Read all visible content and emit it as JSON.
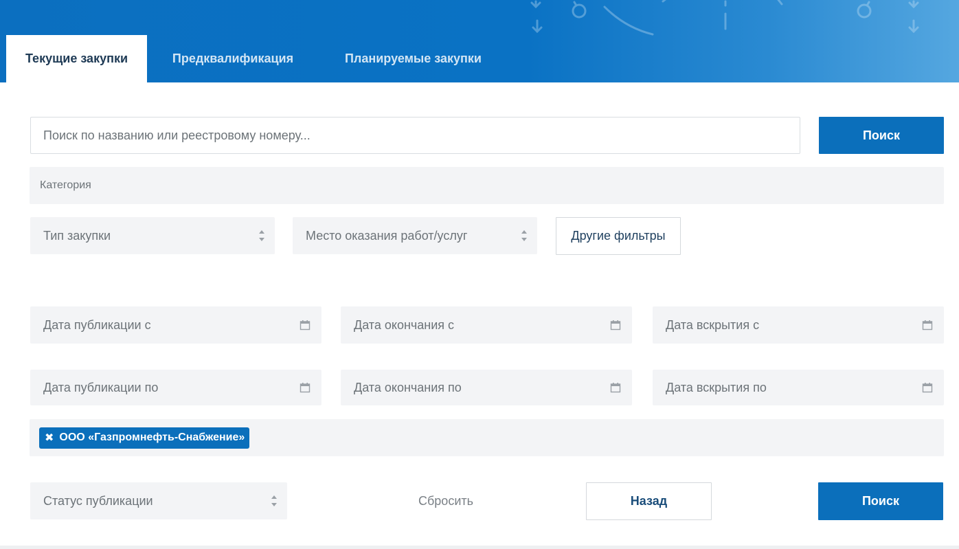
{
  "tabs": [
    {
      "label": "Текущие закупки",
      "active": true
    },
    {
      "label": "Предквалификация",
      "active": false
    },
    {
      "label": "Планируемые закупки",
      "active": false
    }
  ],
  "search": {
    "placeholder": "Поиск по названию или реестровому номеру...",
    "button_label": "Поиск"
  },
  "filters": {
    "category": "Категория",
    "purchase_type": "Тип закупки",
    "location": "Место оказания работ/услуг",
    "other_filters_label": "Другие фильтры"
  },
  "dates": {
    "publication_from": "Дата публикации с",
    "end_from": "Дата окончания с",
    "opening_from": "Дата вскрытия с",
    "publication_to": "Дата публикации по",
    "end_to": "Дата окончания по",
    "opening_to": "Дата вскрытия по"
  },
  "selected_tags": [
    {
      "remove_glyph": "✖",
      "label": "ООО «Газпромнефть-Снабжение»"
    }
  ],
  "bottom": {
    "status": "Статус публикации",
    "reset": "Сбросить",
    "back": "Назад",
    "search": "Поиск"
  },
  "colors": {
    "header_blue": "#0b6fc0",
    "button_blue": "#0b6fbb",
    "field_bg": "#f3f4f6"
  }
}
